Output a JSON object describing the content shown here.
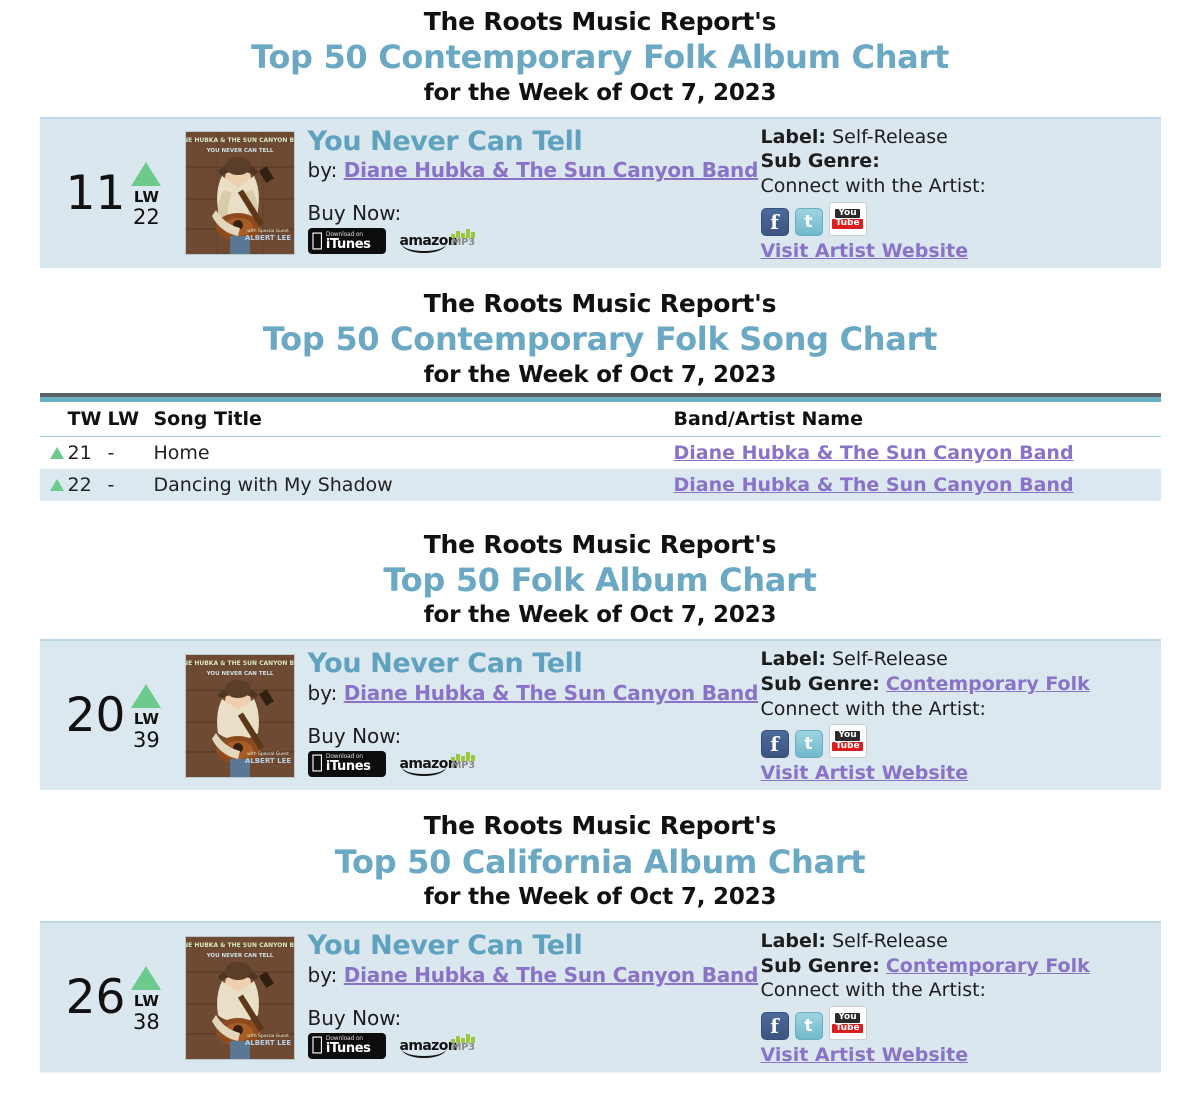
{
  "publisher": "The Roots Music Report's",
  "week_line": "for the Week of Oct 7, 2023",
  "icons": {
    "arrow_up": "up-arrow-icon",
    "facebook": "facebook-icon",
    "twitter": "twitter-icon",
    "youtube": "youtube-icon",
    "itunes": "itunes-badge-icon",
    "amazon": "amazon-mp3-badge-icon"
  },
  "labels": {
    "lw": "LW",
    "by": "by:",
    "buy_now": "Buy Now:",
    "label": "Label:",
    "sub_genre": "Sub Genre:",
    "connect": "Connect with the Artist:",
    "visit": "Visit Artist Website",
    "itunes_small": "Download on",
    "itunes_big": "iTunes",
    "amazon_word": "amazon",
    "amazon_mp3": "MP3",
    "yt_you": "You",
    "yt_tube": "Tube",
    "fb_glyph": "f",
    "tw_glyph": "t"
  },
  "colors": {
    "title_blue": "#6aa8c4",
    "link_purple": "#8a72c8",
    "arrow_green": "#6ccb8c",
    "row_blue": "#dae7ee",
    "table_teal": "#66b2c2",
    "table_dark": "#5a6166"
  },
  "sections": [
    {
      "id": "contemporary-folk-album",
      "chart_title": "Top 50 Contemporary Folk Album Chart",
      "kind": "album",
      "entry": {
        "rank": "11",
        "last_week": "22",
        "album_title": "You Never Can Tell",
        "artist": "Diane Hubka & The Sun Canyon Band",
        "label_value": "Self-Release",
        "sub_genre_value": "",
        "album_art_alt": "You Never Can Tell album cover"
      }
    },
    {
      "id": "contemporary-folk-song",
      "chart_title": "Top 50 Contemporary Folk Song Chart",
      "kind": "song-table",
      "table": {
        "columns": [
          "",
          "TW",
          "LW",
          "Song Title",
          "Band/Artist Name"
        ],
        "rows": [
          {
            "trend": "up",
            "tw": "21",
            "lw": "-",
            "title": "Home",
            "artist": "Diane Hubka & The Sun Canyon Band"
          },
          {
            "trend": "up",
            "tw": "22",
            "lw": "-",
            "title": "Dancing with My Shadow",
            "artist": "Diane Hubka & The Sun Canyon Band"
          }
        ]
      }
    },
    {
      "id": "folk-album",
      "chart_title": "Top 50 Folk Album Chart",
      "kind": "album",
      "entry": {
        "rank": "20",
        "last_week": "39",
        "album_title": "You Never Can Tell",
        "artist": "Diane Hubka & The Sun Canyon Band",
        "label_value": "Self-Release",
        "sub_genre_value": "Contemporary Folk",
        "album_art_alt": "You Never Can Tell album cover"
      }
    },
    {
      "id": "california-album",
      "chart_title": "Top 50 California Album Chart",
      "kind": "album",
      "entry": {
        "rank": "26",
        "last_week": "38",
        "album_title": "You Never Can Tell",
        "artist": "Diane Hubka & The Sun Canyon Band",
        "label_value": "Self-Release",
        "sub_genre_value": "Contemporary Folk",
        "album_art_alt": "You Never Can Tell album cover"
      }
    }
  ]
}
